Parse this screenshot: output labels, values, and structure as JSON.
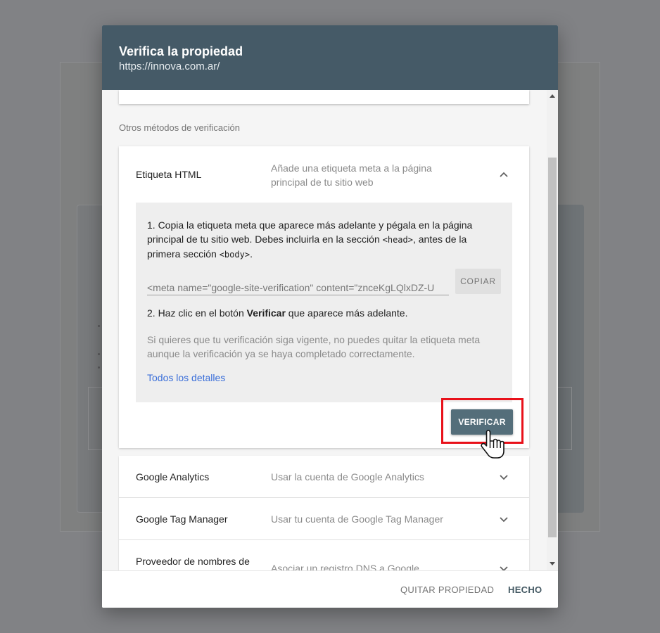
{
  "dialog": {
    "title": "Verifica la propiedad",
    "subtitle": "https://innova.com.ar/"
  },
  "section_label": "Otros métodos de verificación",
  "html_tag_method": {
    "title": "Etiqueta HTML",
    "description": "Añade una etiqueta meta a la página principal de tu sitio web",
    "expanded": true,
    "step1_prefix": "1. Copia la etiqueta meta que aparece más adelante y pégala en la página principal de tu sitio web. Debes incluirla en la sección ",
    "step1_head": "<head>",
    "step1_middle": ", antes de la primera sección ",
    "step1_body": "<body>",
    "step1_end": ".",
    "meta_tag_value": "<meta name=\"google-site-verification\" content=\"znceKgLQlxDZ-U",
    "copy_label": "COPIAR",
    "step2_prefix": "2. Haz clic en el botón ",
    "step2_bold": "Verificar",
    "step2_suffix": " que aparece más adelante.",
    "note": "Si quieres que tu verificación siga vigente, no puedes quitar la etiqueta meta aunque la verificación ya se haya completado correctamente.",
    "details_link": "Todos los detalles",
    "verify_label": "VERIFICAR"
  },
  "other_methods": [
    {
      "title": "Google Analytics",
      "description": "Usar la cuenta de Google Analytics"
    },
    {
      "title": "Google Tag Manager",
      "description": "Usar tu cuenta de Google Tag Manager"
    },
    {
      "title": "Proveedor de nombres de",
      "description": "Asociar un registro DNS a Google"
    }
  ],
  "footer": {
    "remove_label": "QUITAR PROPIEDAD",
    "done_label": "HECHO"
  },
  "colors": {
    "header_bg": "#455a67",
    "verify_button": "#546e7a",
    "highlight_border": "#e8111a",
    "link": "#3b6fd9"
  },
  "icons": {
    "collapse": "chevron-up-icon",
    "expand": "chevron-down-icon",
    "cursor": "hand-pointer-icon"
  }
}
